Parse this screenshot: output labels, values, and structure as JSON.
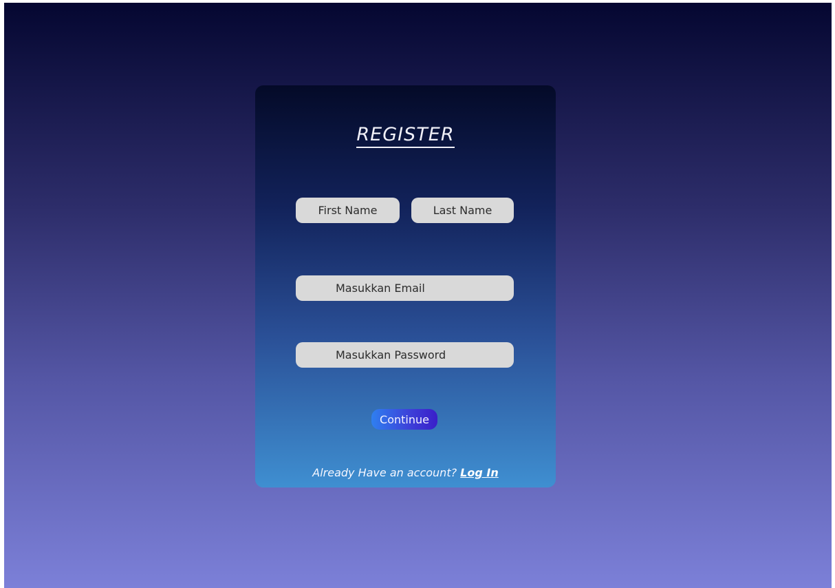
{
  "register": {
    "title": "REGISTER",
    "fields": {
      "first_name_placeholder": "First Name",
      "last_name_placeholder": "Last Name",
      "email_placeholder": "Masukkan Email",
      "password_placeholder": "Masukkan Password"
    },
    "continue_label": "Continue",
    "footer_text": "Already Have an account?",
    "login_label": "Log In"
  },
  "colors": {
    "page_gradient_top": "#050731",
    "page_gradient_bottom": "#7c80d8",
    "card_gradient_top": "#040a28",
    "card_gradient_bottom": "#3f8fd1",
    "field_bg": "#d9d9d9",
    "button_start": "#2f7ff0",
    "button_end": "#3a1ec9"
  }
}
